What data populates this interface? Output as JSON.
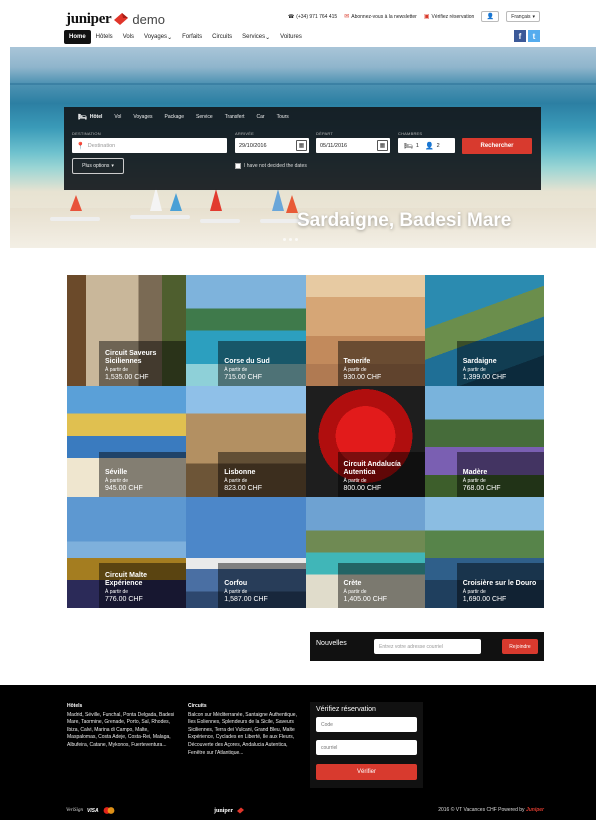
{
  "header": {
    "logo_word": "juniper",
    "logo_demo": "demo",
    "phone": "(+34) 971 764 415",
    "newsletter_link": "Abonnez-vous à la newsletter",
    "verify_link": "Vérifiez réservation",
    "language": "Français"
  },
  "nav": {
    "items": [
      "Home",
      "Hôtels",
      "Vols",
      "Voyages",
      "Forfaits",
      "Circuits",
      "Services",
      "Voitures"
    ],
    "active": "Home"
  },
  "social": {
    "facebook": "f",
    "twitter": "t"
  },
  "hero": {
    "caption": "Sardaigne, Badesi Mare"
  },
  "search": {
    "tabs": [
      "Hôtel",
      "Vol",
      "Voyages",
      "Package",
      "Service",
      "Transfert",
      "Car",
      "Tours"
    ],
    "active_tab": "Hôtel",
    "destination_label": "DESTINATION",
    "destination_placeholder": "Destination",
    "arrival_label": "ARRIVÉE",
    "arrival_value": "29/10/2016",
    "departure_label": "DÉPART",
    "departure_value": "05/11/2016",
    "rooms_label": "CHAMBRES",
    "rooms_value": "1",
    "guests_value": "2",
    "search_button": "Rechercher",
    "more_options": "Plus options",
    "no_dates": "I have not decided the dates"
  },
  "destinations": [
    {
      "name": "Circuit Saveurs Siciliennes",
      "from": "À partir de",
      "price": "1,535.00 CHF"
    },
    {
      "name": "Corse du Sud",
      "from": "À partir de",
      "price": "715.00 CHF"
    },
    {
      "name": "Tenerife",
      "from": "À partir de",
      "price": "930.00 CHF"
    },
    {
      "name": "Sardaigne",
      "from": "À partir de",
      "price": "1,399.00 CHF"
    },
    {
      "name": "Séville",
      "from": "À partir de",
      "price": "945.00 CHF"
    },
    {
      "name": "Lisbonne",
      "from": "À partir de",
      "price": "823.00 CHF"
    },
    {
      "name": "Circuit Andalucía Autentica",
      "from": "À partir de",
      "price": "800.00 CHF"
    },
    {
      "name": "Madère",
      "from": "À partir de",
      "price": "768.00 CHF"
    },
    {
      "name": "Circuit Malte Expérience",
      "from": "À partir de",
      "price": "776.00 CHF"
    },
    {
      "name": "Corfou",
      "from": "À partir de",
      "price": "1,587.00 CHF"
    },
    {
      "name": "Crète",
      "from": "À partir de",
      "price": "1,405.00 CHF"
    },
    {
      "name": "Croisière sur le Douro",
      "from": "À partir de",
      "price": "1,690.00 CHF"
    }
  ],
  "newsletter": {
    "title": "Nouvelles",
    "placeholder": "Entrez votre adresse courriel",
    "button": "Rejoindre"
  },
  "footer": {
    "hotels_title": "Hôtels",
    "hotels_text": "Madrid, Séville, Funchal, Ponta Delgada, Badesi Mare, Taormine, Grenade, Porto, Sal, Rhodes, Ibiza, Calvi, Marina di Campo, Malte, Maspalomas, Costa Adeje, Costa-Rei, Malaga, Albufeira, Catane, Mykonos, Fuerteventura...",
    "circuits_title": "Circuits",
    "circuits_text": "Balcon sur Méditerranée, Santaigne Authentique, Iles Eoliennes, Splendeurs de la Sicile, Saveurs Siciliennes, Terra dei Vulcani, Grand Bleu, Malte Expérience, Cyclades en Liberté, Ile aux Fleurs, Découverte des Açores, Andalucia Autentica, Fenêtre sur l'Atlantique...",
    "verify_title": "Vérifiez réservation",
    "code_placeholder": "Code",
    "email_placeholder": "courriel",
    "verify_button": "Vérifier",
    "payment_verisign": "VeriSign",
    "payment_visa": "VISA",
    "footer_logo": "juniper",
    "copyright": "2016 © VT Vacances CHF Powered by",
    "copyright_brand": "Juniper"
  }
}
